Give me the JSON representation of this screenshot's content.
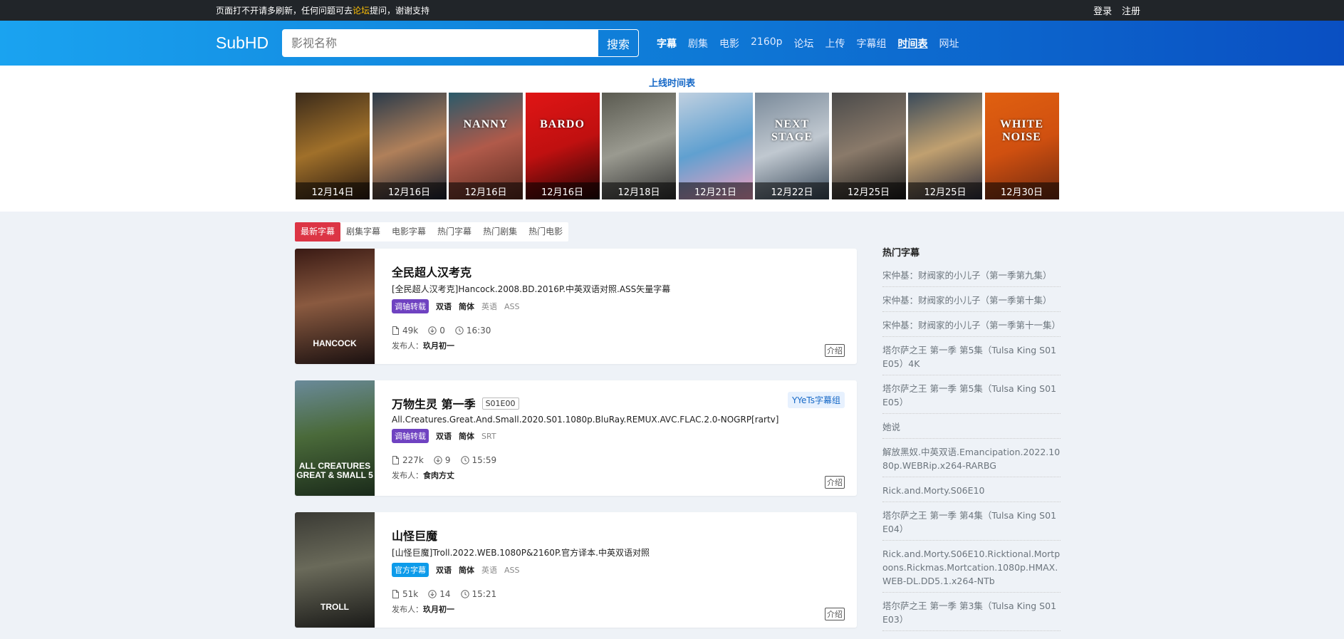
{
  "topbar": {
    "notice_prefix": "页面打不开请多刷新，任何问题可去",
    "notice_link": "论坛",
    "notice_suffix": "提问，谢谢支持",
    "login": "登录",
    "register": "注册"
  },
  "header": {
    "logo": "SubHD",
    "search_placeholder": "影视名称",
    "search_button": "搜索",
    "nav": [
      "字幕",
      "剧集",
      "电影",
      "2160p",
      "论坛",
      "上传",
      "字幕组",
      "时间表",
      "网址"
    ]
  },
  "schedule": {
    "title": "上线时间表",
    "posters": [
      {
        "date": "12月14日",
        "word": "",
        "colors": [
          "#3a2a1a",
          "#a0702a",
          "#2a1a10"
        ]
      },
      {
        "date": "12月16日",
        "word": "",
        "colors": [
          "#2a3a4a",
          "#b0805a",
          "#1a2030"
        ]
      },
      {
        "date": "12月16日",
        "word": "NANNY",
        "colors": [
          "#2a5a6a",
          "#b05a4a",
          "#5a2a20"
        ]
      },
      {
        "date": "12月16日",
        "word": "BARDO",
        "colors": [
          "#e01515",
          "#c01010",
          "#200505"
        ]
      },
      {
        "date": "12月18日",
        "word": "",
        "colors": [
          "#5a5a50",
          "#9a9a90",
          "#303030"
        ]
      },
      {
        "date": "12月21日",
        "word": "",
        "colors": [
          "#c0d0e0",
          "#60a0d0",
          "#f0a0c0"
        ]
      },
      {
        "date": "12月22日",
        "word": "NEXT STAGE",
        "colors": [
          "#7a8a9a",
          "#c0c8d0",
          "#3a4a5a"
        ]
      },
      {
        "date": "12月25日",
        "word": "",
        "colors": [
          "#4a4a4a",
          "#8a7a6a",
          "#1a1a1a"
        ]
      },
      {
        "date": "12月25日",
        "word": "",
        "colors": [
          "#3a4a5a",
          "#c0a070",
          "#2a2a3a"
        ]
      },
      {
        "date": "12月30日",
        "word": "WHITE NOISE",
        "colors": [
          "#e06010",
          "#d05010",
          "#702a10"
        ]
      }
    ]
  },
  "tabs": [
    "最新字幕",
    "剧集字幕",
    "电影字幕",
    "热门字幕",
    "热门剧集",
    "热门电影"
  ],
  "subtitles": [
    {
      "title": "全民超人汉考克",
      "episode": "",
      "group": "",
      "release": "[全民超人汉考克]Hancock.2008.BD.2016P.中英双语对照.ASS矢量字幕",
      "badge": "调轴转载",
      "badge_color": "purple",
      "bold_tags": [
        "双语",
        "简体"
      ],
      "gray_tags": [
        "英语",
        "ASS"
      ],
      "size": "49k",
      "downloads": "0",
      "time": "16:30",
      "uploader_label": "发布人：",
      "uploader": "玖月初一",
      "intro": "介绍",
      "thumb_word": "HANCOCK",
      "thumb_colors": [
        "#3a1a14",
        "#8a5a40",
        "#1a1010"
      ]
    },
    {
      "title": "万物生灵 第一季",
      "episode": "S01E00",
      "group": "YYeTs字幕组",
      "release": "All.Creatures.Great.And.Small.2020.S01.1080p.BluRay.REMUX.AVC.FLAC.2.0-NOGRP[rartv]",
      "badge": "调轴转载",
      "badge_color": "purple",
      "bold_tags": [
        "双语",
        "简体"
      ],
      "gray_tags": [
        "SRT"
      ],
      "size": "227k",
      "downloads": "9",
      "time": "15:59",
      "uploader_label": "发布人：",
      "uploader": "食肉方丈",
      "intro": "介绍",
      "thumb_word": "ALL CREATURES GREAT & SMALL 5",
      "thumb_colors": [
        "#6a8a9a",
        "#4a6a3a",
        "#1a2a1a"
      ]
    },
    {
      "title": "山怪巨魔",
      "episode": "",
      "group": "",
      "release": "[山怪巨魔]Troll.2022.WEB.1080P&2160P.官方译本.中英双语对照",
      "badge": "官方字幕",
      "badge_color": "blue",
      "bold_tags": [
        "双语",
        "简体"
      ],
      "gray_tags": [
        "英语",
        "ASS"
      ],
      "size": "51k",
      "downloads": "14",
      "time": "15:21",
      "uploader_label": "发布人：",
      "uploader": "玖月初一",
      "intro": "介绍",
      "thumb_word": "TROLL",
      "thumb_colors": [
        "#3a3a34",
        "#6a6a5a",
        "#1a1a18"
      ]
    }
  ],
  "sidebar": {
    "title": "热门字幕",
    "items": [
      "宋仲基：财阀家的小儿子（第一季第九集）",
      "宋仲基：财阀家的小儿子（第一季第十集）",
      "宋仲基：财阀家的小儿子（第一季第十一集）",
      "塔尔萨之王 第一季 第5集（Tulsa King S01E05）4K",
      "塔尔萨之王 第一季 第5集（Tulsa King S01E05）",
      "她说",
      "解放黑奴.中英双语.Emancipation.2022.1080p.WEBRip.x264-RARBG",
      "Rick.and.Morty.S06E10",
      "塔尔萨之王 第一季 第4集（Tulsa King S01E04）",
      "Rick.and.Morty.S06E10.Ricktional.Mortpoons.Rickmas.Mortcation.1080p.HMAX.WEB-DL.DD5.1.x264-NTb",
      "塔尔萨之王 第一季 第3集（Tulsa King S01E03）"
    ]
  },
  "colors": {
    "accent_red": "#dc3545",
    "purple": "#6f42c1",
    "blue": "#0d9bea",
    "header_start": "#1aa3f0",
    "header_end": "#0a4fc2"
  }
}
